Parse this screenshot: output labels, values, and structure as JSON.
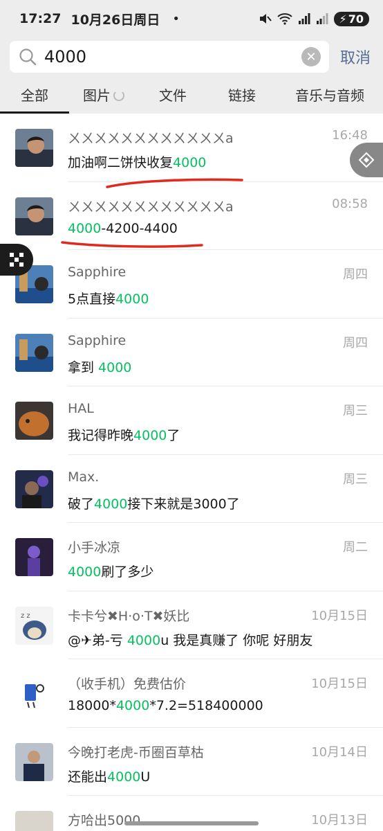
{
  "status": {
    "time": "17:27",
    "date": "10月26日周日",
    "dot": "•",
    "battery": "70"
  },
  "search": {
    "query": "4000",
    "cancel_label": "取消"
  },
  "tabs": [
    {
      "label": "全部",
      "active": true
    },
    {
      "label": "图片"
    },
    {
      "label": "文件"
    },
    {
      "label": "链接"
    },
    {
      "label": "音乐与音频"
    }
  ],
  "results": [
    {
      "name": "ㄨㄨㄨㄨㄨㄨㄨㄨㄨㄨㄨㄨa",
      "time": "16:48",
      "msg_pre": "加油啊二饼快收复",
      "msg_hl": "4000",
      "msg_post": ""
    },
    {
      "name": "ㄨㄨㄨㄨㄨㄨㄨㄨㄨㄨㄨㄨa",
      "time": "08:58",
      "msg_pre": "",
      "msg_hl": "4000",
      "msg_post": "-4200-4400"
    },
    {
      "name": "Sapphire",
      "time": "周四",
      "msg_pre": "5点直接",
      "msg_hl": "4000",
      "msg_post": ""
    },
    {
      "name": "Sapphire",
      "time": "周四",
      "msg_pre": "拿到 ",
      "msg_hl": "4000",
      "msg_post": ""
    },
    {
      "name": "HAL",
      "time": "周三",
      "msg_pre": "我记得昨晚",
      "msg_hl": "4000",
      "msg_post": "了"
    },
    {
      "name": "Max.",
      "time": "周三",
      "msg_pre": "破了",
      "msg_hl": "4000",
      "msg_post": "接下来就是3000了"
    },
    {
      "name": "小手冰凉",
      "time": "周二",
      "msg_pre": "",
      "msg_hl": "4000",
      "msg_post": "刷了多少"
    },
    {
      "name": "卡卡兮✖H·o·T✖妖比",
      "time": "10月15日",
      "msg_pre": "@✈弟-亏 ",
      "msg_hl": "4000",
      "msg_post": "u 我是真赚了 你呢 好朋友"
    },
    {
      "name": "（收手机）免费估价",
      "time": "10月15日",
      "msg_pre": "18000*",
      "msg_hl": "4000",
      "msg_post": "*7.2=518400000"
    },
    {
      "name": "今晚打老虎-币圈百草枯",
      "time": "10月14日",
      "msg_pre": "还能出",
      "msg_hl": "4000",
      "msg_post": "U"
    },
    {
      "name": "方哈出5000",
      "time": "10月13日",
      "msg_pre": "",
      "msg_hl": "",
      "msg_post": ""
    }
  ],
  "colors": {
    "highlight": "#07c160",
    "annotation": "#e02a1e",
    "link": "#576b95"
  }
}
